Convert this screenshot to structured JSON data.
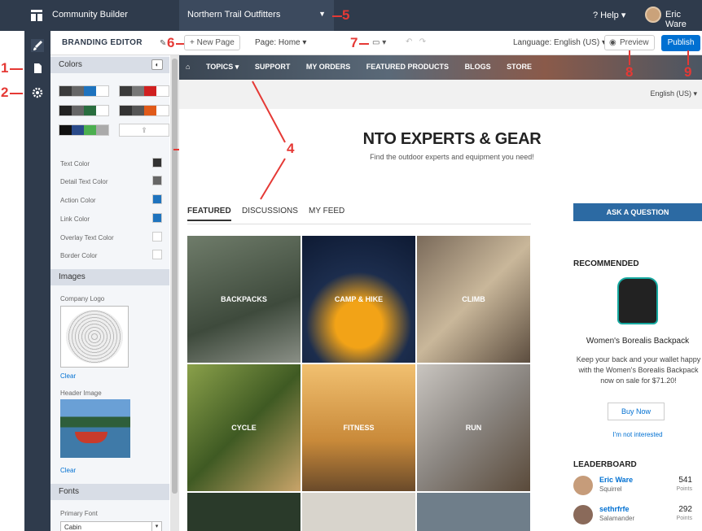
{
  "topbar": {
    "app_title": "Community Builder",
    "community": "Northern Trail Outfitters",
    "help": "? Help ▾",
    "user": "Eric Ware"
  },
  "toolbar": {
    "editor": "BRANDING EDITOR",
    "new_page": "+ New Page",
    "page": "Page: Home ▾",
    "language": "Language: English (US) ▾",
    "preview": "Preview",
    "publish": "Publish"
  },
  "callouts": [
    "1",
    "2",
    "3",
    "4",
    "5",
    "6",
    "7",
    "8",
    "9"
  ],
  "panel": {
    "colors_title": "Colors",
    "color_rows": [
      {
        "label": "Text Color",
        "color": "#333333"
      },
      {
        "label": "Detail Text Color",
        "color": "#666666"
      },
      {
        "label": "Action Color",
        "color": "#1e73be"
      },
      {
        "label": "Link Color",
        "color": "#1e73be"
      },
      {
        "label": "Overlay Text Color",
        "color": "#ffffff"
      },
      {
        "label": "Border Color",
        "color": "#ffffff"
      }
    ],
    "images_title": "Images",
    "company_logo": "Company Logo",
    "clear": "Clear",
    "header_image": "Header Image",
    "fonts_title": "Fonts",
    "primary_font": "Primary Font",
    "font_value": "Cabin"
  },
  "preview": {
    "nav": [
      "TOPICS ▾",
      "SUPPORT",
      "MY ORDERS",
      "FEATURED PRODUCTS",
      "BLOGS",
      "STORE"
    ],
    "lang": "English (US) ▾",
    "title": "NTO EXPERTS & GEAR",
    "subtitle": "Find the outdoor experts and equipment you need!",
    "tabs": [
      "FEATURED",
      "DISCUSSIONS",
      "MY FEED"
    ],
    "tiles": [
      "BACKPACKS",
      "CAMP & HIKE",
      "CLIMB",
      "CYCLE",
      "FITNESS",
      "RUN"
    ],
    "ask": "ASK A QUESTION",
    "recommended": "RECOMMENDED",
    "product_name": "Women's Borealis Backpack",
    "product_desc": "Keep your back and your wallet happy with the Women's Borealis Backpack now on sale for $71.20!",
    "buy": "Buy Now",
    "not_interested": "I'm not interested",
    "leaderboard": "LEADERBOARD",
    "leaders": [
      {
        "name": "Eric Ware",
        "rank": "Squirrel",
        "points": "541",
        "unit": "Points"
      },
      {
        "name": "sethrfrfe",
        "rank": "Salamander",
        "points": "292",
        "unit": "Points"
      }
    ]
  }
}
